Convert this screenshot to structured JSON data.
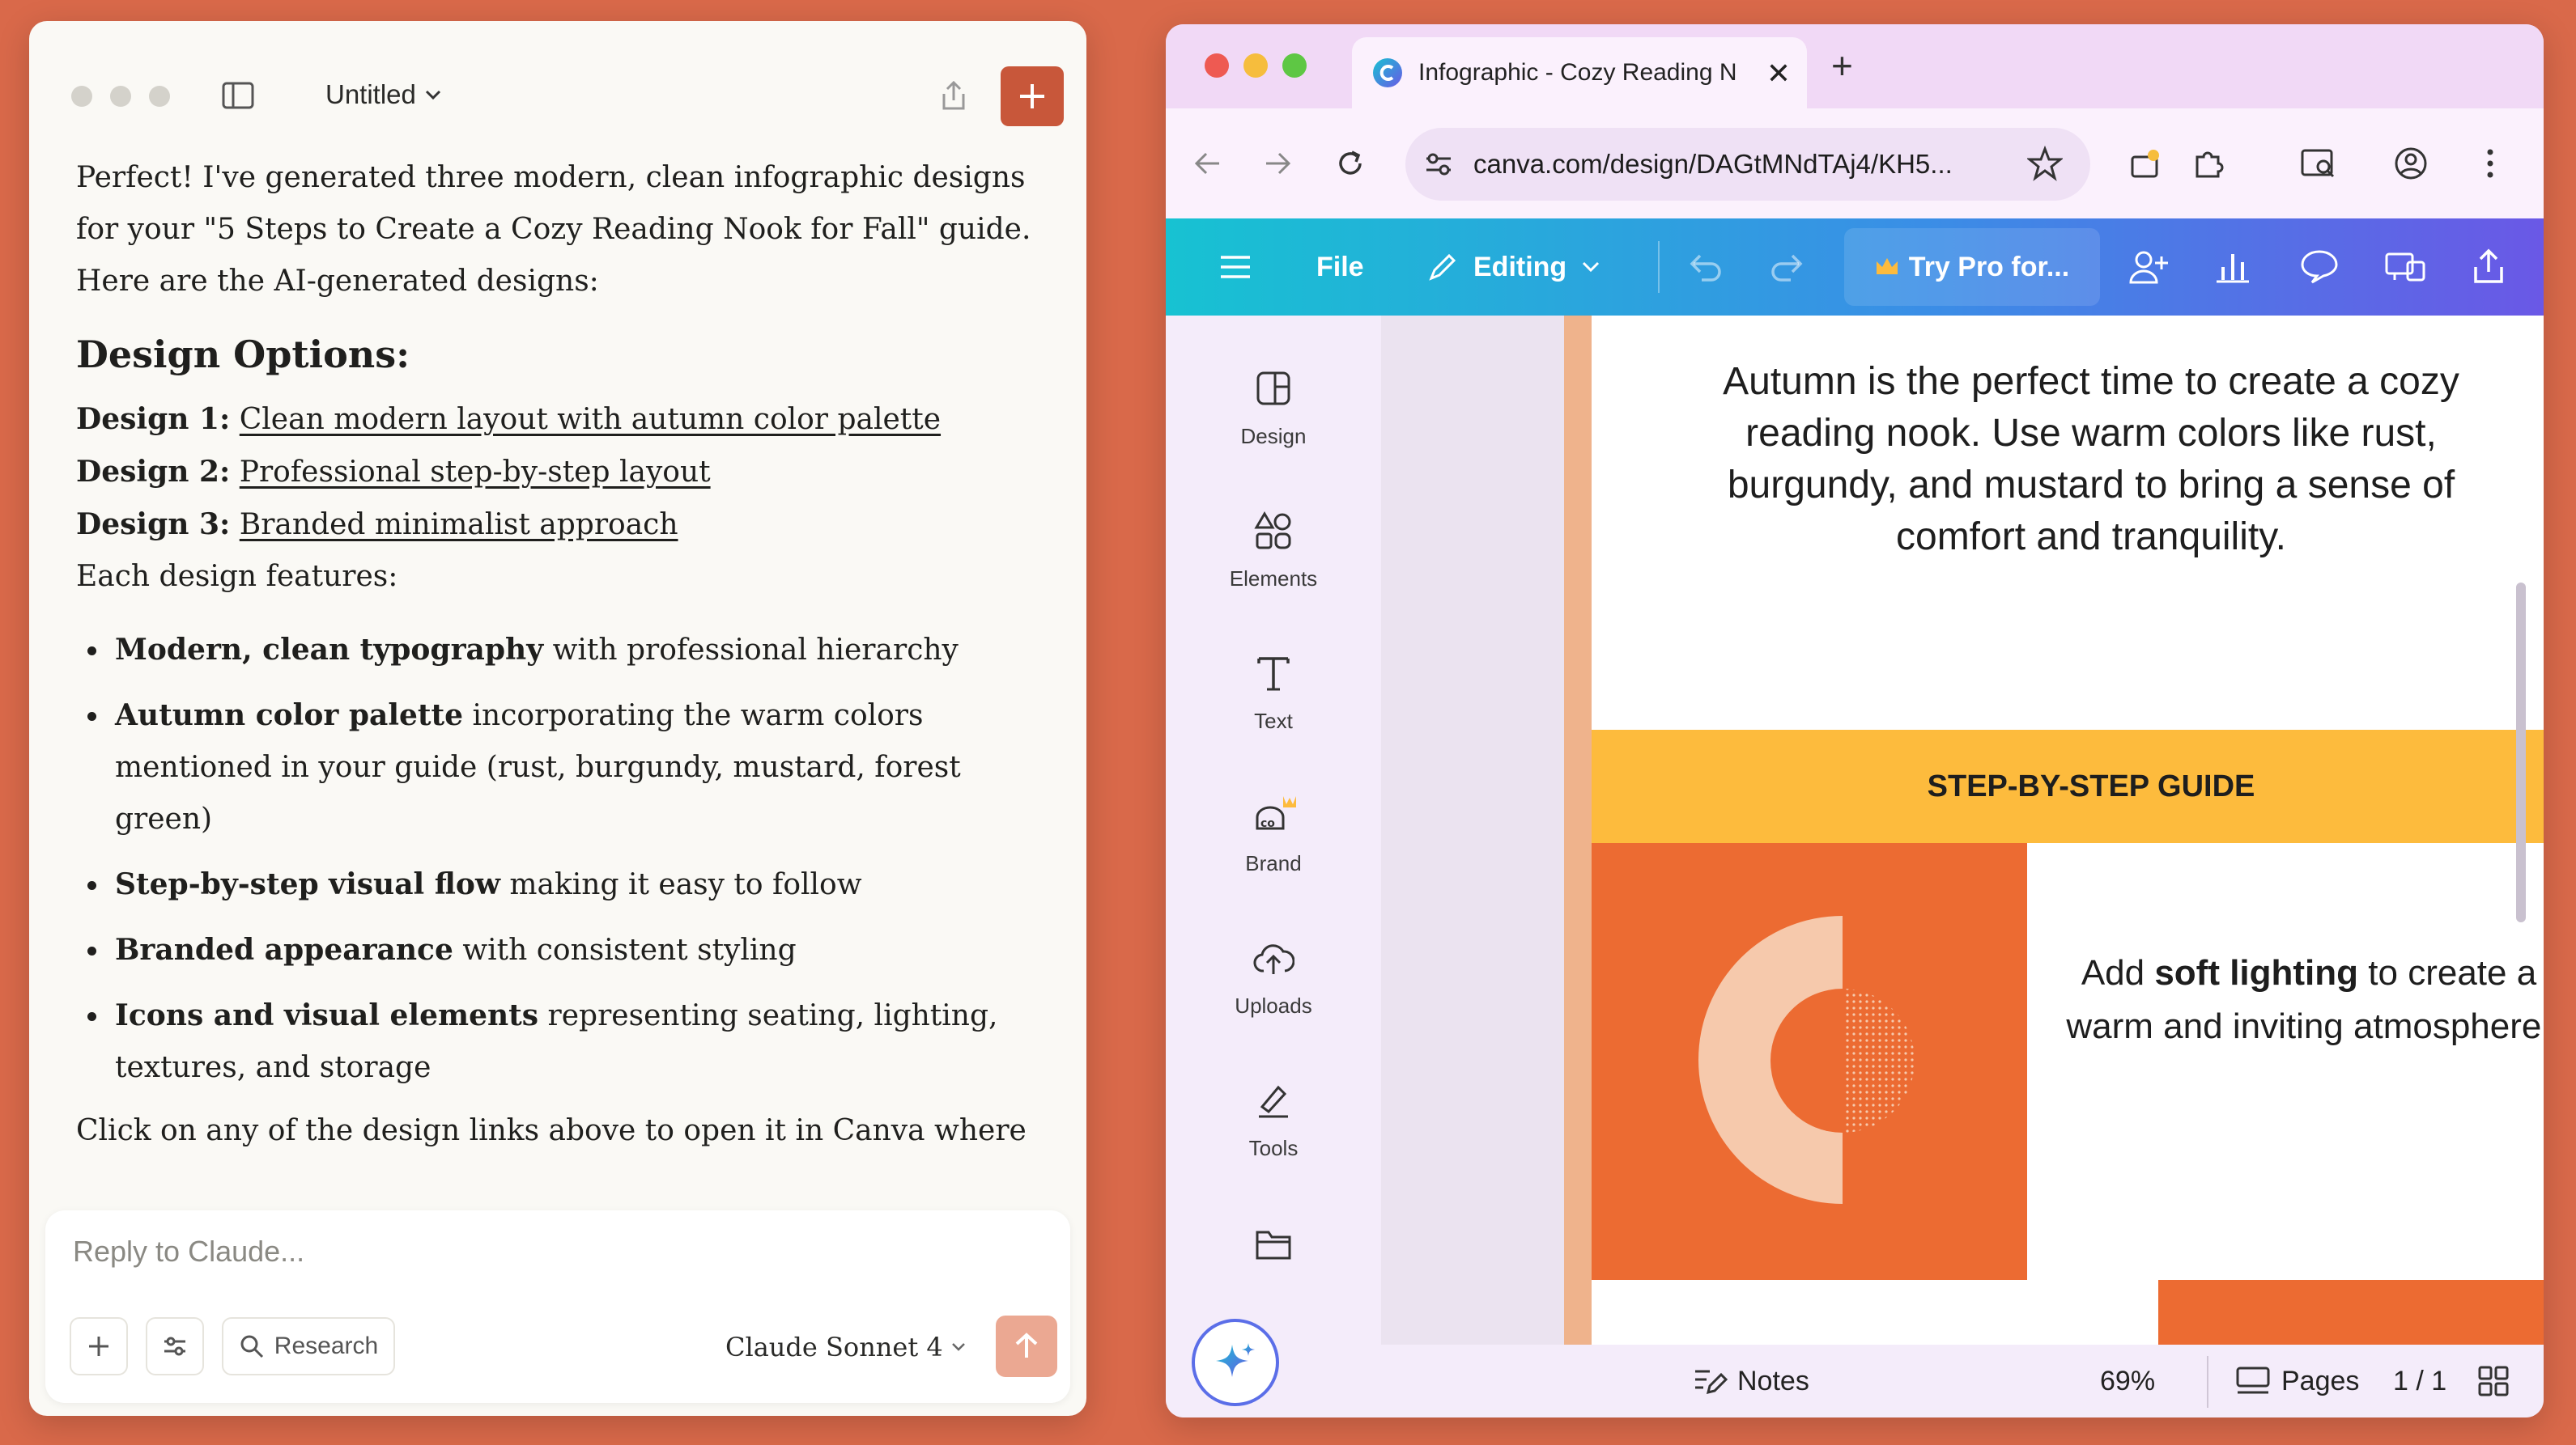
{
  "claude": {
    "title": "Untitled",
    "intro": "Perfect! I've generated three modern, clean infographic designs for your \"5 Steps to Create a Cozy Reading Nook for Fall\" guide. Here are the AI-generated designs:",
    "heading": "Design Options:",
    "designs": [
      {
        "label": "Design 1:",
        "link": "Clean modern layout with autumn color palette"
      },
      {
        "label": "Design 2:",
        "link": "Professional step-by-step layout"
      },
      {
        "label": "Design 3:",
        "link": "Branded minimalist approach"
      }
    ],
    "features_intro": "Each design features:",
    "features": [
      {
        "bold": "Modern, clean typography",
        "rest": " with professional hierarchy"
      },
      {
        "bold": "Autumn color palette",
        "rest": " incorporating the warm colors mentioned in your guide (rust, burgundy, mustard, forest green)"
      },
      {
        "bold": "Step-by-step visual flow",
        "rest": " making it easy to follow"
      },
      {
        "bold": "Branded appearance",
        "rest": " with consistent styling"
      },
      {
        "bold": "Icons and visual elements",
        "rest": " representing seating, lighting, textures, and storage"
      }
    ],
    "closing": "Click on any of the design links above to open it in Canva where",
    "composer": {
      "placeholder": "Reply to Claude...",
      "research_label": "Research",
      "model": "Claude Sonnet 4"
    },
    "colors": {
      "accent": "#c8573a",
      "send": "#eba892"
    }
  },
  "browser": {
    "tab_title": "Infographic - Cozy Reading N",
    "url": "canva.com/design/DAGtMNdTAj4/KH5...",
    "canva": {
      "menu": {
        "file": "File",
        "editing": "Editing",
        "try_pro": "Try Pro for..."
      },
      "side": [
        "Design",
        "Elements",
        "Text",
        "Brand",
        "Uploads",
        "Tools"
      ],
      "intro_text": "Autumn is the perfect time to create a cozy reading nook. Use warm colors like rust, burgundy, and mustard to bring a sense of comfort and tranquility.",
      "banner": "STEP-BY-STEP GUIDE",
      "step": {
        "pre": "Add ",
        "bold": "soft lighting",
        "post": " to create a warm and inviting atmosphere."
      },
      "footer": {
        "notes": "Notes",
        "zoom": "69%",
        "pages": "Pages",
        "page_count": "1 / 1"
      },
      "colors": {
        "header_start": "#17c2d2",
        "header_end": "#6a58e6",
        "banner": "#fdbb3d",
        "orange": "#ec6b32",
        "peach": "#efb38c"
      }
    }
  },
  "icons": [
    "sidebar-toggle-icon",
    "share-icon",
    "plus-icon",
    "sliders-icon",
    "search-icon",
    "arrow-up-icon",
    "canva-logo-icon",
    "back-icon",
    "forward-icon",
    "reload-icon",
    "site-settings-icon",
    "star-icon",
    "extension-icon",
    "puzzle-icon",
    "tab-search-icon",
    "profile-icon",
    "menu-dots-icon",
    "hamburger-icon",
    "pencil-icon",
    "undo-icon",
    "redo-icon",
    "crown-icon",
    "collaborate-icon",
    "chart-icon",
    "comment-icon",
    "present-icon",
    "export-icon",
    "design-icon",
    "elements-icon",
    "text-icon",
    "brand-icon",
    "uploads-icon",
    "tools-icon",
    "folder-icon",
    "magic-icon",
    "notes-icon",
    "pages-icon",
    "grid-icon",
    "fullscreen-icon",
    "help-icon"
  ]
}
